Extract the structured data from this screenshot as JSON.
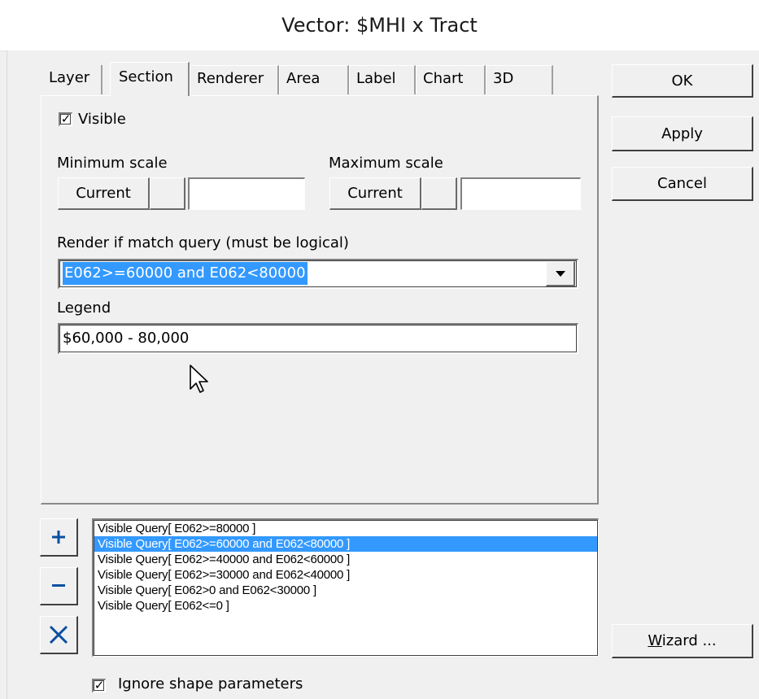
{
  "window": {
    "title": "Vector: $MHI x Tract"
  },
  "tabs": [
    {
      "label": "Layer"
    },
    {
      "label": "Section",
      "active": true
    },
    {
      "label": "Renderer"
    },
    {
      "label": "Area"
    },
    {
      "label": "Label"
    },
    {
      "label": "Chart"
    },
    {
      "label": "3D"
    }
  ],
  "section": {
    "visible_label": "Visible",
    "visible_checked": true,
    "min_scale": {
      "label": "Minimum scale",
      "current_label": "Current",
      "value": ""
    },
    "max_scale": {
      "label": "Maximum scale",
      "current_label": "Current",
      "value": ""
    },
    "query_label": "Render if match query (must be logical)",
    "query_value": "E062>=60000 and E062<80000",
    "legend_label": "Legend",
    "legend_value": "$60,000 - 80,000"
  },
  "buttons": {
    "ok": "OK",
    "apply": "Apply",
    "cancel": "Cancel",
    "wizard": "Wizard ..."
  },
  "queries": [
    "Visible Query[ E062>=80000 ]",
    "Visible Query[ E062>=60000 and E062<80000 ]",
    "Visible Query[ E062>=40000 and E062<60000 ]",
    "Visible Query[ E062>=30000 and E062<40000 ]",
    "Visible Query[ E062>0 and E062<30000 ]",
    "Visible Query[ E062<=0 ]"
  ],
  "selected_query": 1,
  "ignore_shape": {
    "label": "Ignore shape parameters",
    "checked": true
  },
  "icons": {
    "add": "plus-icon",
    "remove": "minus-icon",
    "delete": "x-icon",
    "pointer": "cursor-icon",
    "dropdown": "dropdown-arrow-icon"
  },
  "colors": {
    "selection": "#3399ff",
    "side_button_icon": "#0a4fa0"
  }
}
